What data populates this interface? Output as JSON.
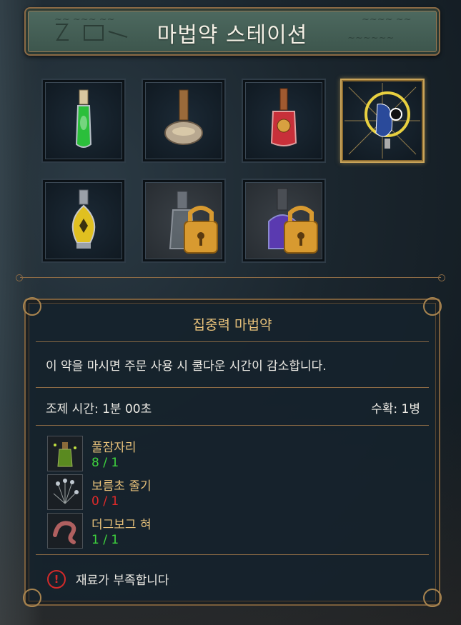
{
  "title": "마법약 스테이션",
  "potions": [
    {
      "icon": "green-potion-icon",
      "locked": false,
      "selected": false
    },
    {
      "icon": "round-flask-potion-icon",
      "locked": false,
      "selected": false
    },
    {
      "icon": "red-potion-icon",
      "locked": false,
      "selected": false
    },
    {
      "icon": "focus-potion-icon",
      "locked": false,
      "selected": true
    },
    {
      "icon": "yellow-potion-icon",
      "locked": false,
      "selected": false
    },
    {
      "icon": "locked-clear-potion-icon",
      "locked": true,
      "selected": false
    },
    {
      "icon": "locked-purple-potion-icon",
      "locked": true,
      "selected": false
    }
  ],
  "detail": {
    "name": "집중력 마법약",
    "description": "이 약을 마시면 주문 사용 시 쿨다운 시간이 감소합니다.",
    "brew_time_label": "조제 시간:",
    "brew_time_value": "1분 00초",
    "yield_label": "수확:",
    "yield_value": "1병",
    "ingredients": [
      {
        "name": "풀잠자리",
        "count": "8 / 1",
        "status": "enough",
        "icon": "lacewing-fly-icon"
      },
      {
        "name": "보름초 줄기",
        "count": "0 / 1",
        "status": "missing",
        "icon": "fluxweed-stem-icon"
      },
      {
        "name": "더그보그 혀",
        "count": "1 / 1",
        "status": "enough",
        "icon": "dugbog-tongue-icon"
      }
    ],
    "warning": "재료가 부족합니다"
  },
  "colors": {
    "enough": "#3ed23e",
    "missing": "#e02a2a",
    "accent": "#e6c07a"
  }
}
